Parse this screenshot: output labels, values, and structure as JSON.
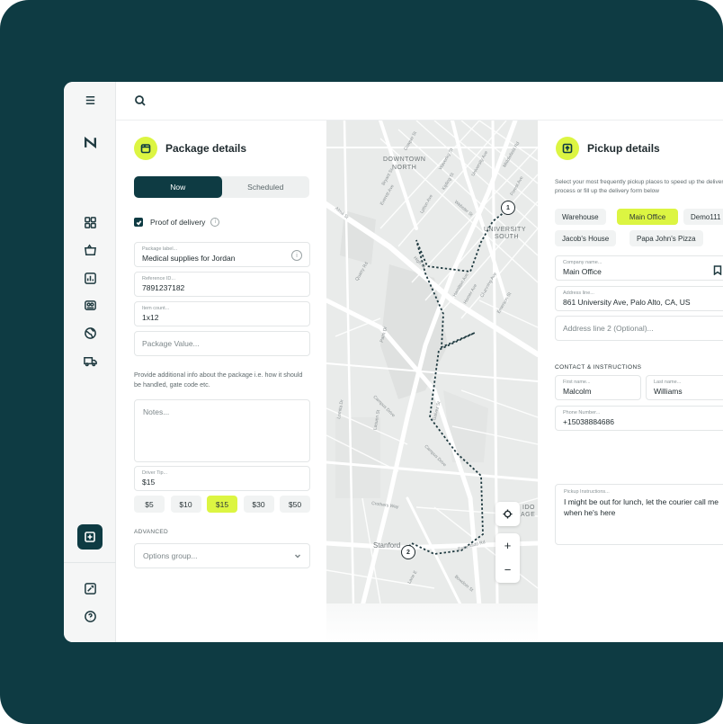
{
  "sidebar": {
    "icons": [
      "menu-icon",
      "logo-icon",
      "dashboard-icon",
      "package-icon",
      "reports-icon",
      "contacts-icon",
      "globe-icon",
      "truck-icon",
      "add-icon",
      "settings-icon",
      "help-icon"
    ]
  },
  "package": {
    "title": "Package details",
    "toggle": {
      "now": "Now",
      "scheduled": "Scheduled"
    },
    "proof_label": "Proof of delivery",
    "fields": {
      "label": {
        "label": "Package label...",
        "value": "Medical supplies for Jordan"
      },
      "reference": {
        "label": "Reference ID...",
        "value": "7891237182"
      },
      "count": {
        "label": "Item count...",
        "value": "1x12"
      },
      "value_placeholder": "Package Value..."
    },
    "info_text": "Provide additional info about the package i.e. how it should be handled, gate code etc.",
    "notes_placeholder": "Notes...",
    "tip": {
      "label": "Driver Tip...",
      "value": "$15"
    },
    "tip_options": [
      "$5",
      "$10",
      "$15",
      "$30",
      "$50"
    ],
    "tip_selected": "$15",
    "advanced_label": "ADVANCED",
    "options_placeholder": "Options group..."
  },
  "map": {
    "labels": {
      "downtown1": "DOWNTOWN",
      "downtown2": "NORTH",
      "university1": "UNIVERSITY",
      "university2": "SOUTH",
      "stanford": "Stanford",
      "ido": "IDO",
      "age": "AGE"
    },
    "streets": [
      "Alma St",
      "Quarry Rd",
      "Palm Dr",
      "Campus Drive",
      "Galvez St",
      "Lomita Dr",
      "Lasuen St",
      "Crothers Way",
      "Escondido Rd",
      "Bowdoin St",
      "Lane E",
      "Campus Drive",
      "Bryant St",
      "Cowper St",
      "Waverley St",
      "Lytton Ave",
      "University Ave",
      "Middlefield Rd",
      "Webster St",
      "Forest Ave",
      "Channing Ave",
      "High St",
      "Hamilton Ave",
      "Homer Ave",
      "Everett Ave",
      "Kipling St",
      "Emerson St"
    ],
    "markers": [
      "1",
      "2"
    ],
    "zoom_in": "+",
    "zoom_out": "−"
  },
  "pickup": {
    "title": "Pickup details",
    "description": "Select your most frequently pickup places to speed up the delivery process or fill up the delivery form below",
    "places": [
      "Warehouse",
      "Main Office",
      "Demo111",
      "Jacob's House",
      "Papa John's Pizza"
    ],
    "selected_place": "Main Office",
    "company": {
      "label": "Company name...",
      "value": "Main Office"
    },
    "address": {
      "label": "Address line...",
      "value": "861 University Ave, Palo Alto, CA, US"
    },
    "address2_placeholder": "Address line 2 (Optional)...",
    "contact_title": "CONTACT & INSTRUCTIONS",
    "first_name": {
      "label": "First name...",
      "value": "Malcolm"
    },
    "last_name": {
      "label": "Last name...",
      "value": "Williams"
    },
    "phone": {
      "label": "Phone Number...",
      "value": "+15038884686"
    },
    "instructions": {
      "label": "Pickup Instructions...",
      "value": "I might be out for lunch, let the courier call me when he's here"
    }
  },
  "colors": {
    "brand": "#0e3b43",
    "accent": "#dcf542"
  }
}
